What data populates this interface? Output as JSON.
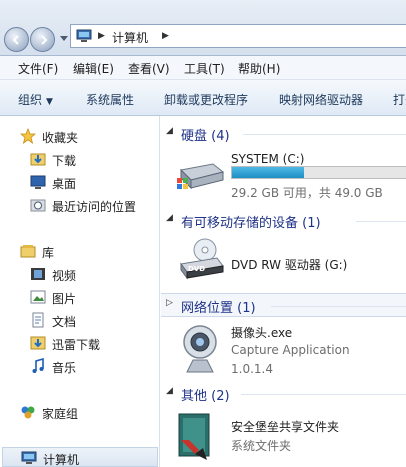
{
  "address": {
    "location": "计算机"
  },
  "menu": {
    "items": [
      "文件(F)",
      "编辑(E)",
      "查看(V)",
      "工具(T)",
      "帮助(H)"
    ]
  },
  "toolbar": {
    "organize": "组织",
    "system_properties": "系统属性",
    "uninstall": "卸载或更改程序",
    "map_drive": "映射网络驱动器",
    "open_cp": "打开"
  },
  "navpane": {
    "favorites": "收藏夹",
    "downloads": "下载",
    "desktop": "桌面",
    "recent": "最近访问的位置",
    "libraries": "库",
    "videos": "视频",
    "pictures": "图片",
    "documents": "文档",
    "thunder": "迅雷下载",
    "music": "音乐",
    "homegroup": "家庭组",
    "computer": "计算机"
  },
  "content": {
    "hard_disks": {
      "title": "硬盘 (4)",
      "drive_c": {
        "name": "SYSTEM (C:)",
        "free_text": "29.2 GB 可用，共 49.0 GB",
        "used_fraction": 0.404
      }
    },
    "removable": {
      "title": "有可移动存储的设备 (1)",
      "dvd": {
        "name": "DVD RW 驱动器 (G:)",
        "badge": "DVD"
      }
    },
    "network": {
      "title": "网络位置 (1)",
      "camera": {
        "name": "摄像头.exe",
        "desc": "Capture Application",
        "version": "1.0.1.4"
      }
    },
    "other": {
      "title": "其他 (2)",
      "share": {
        "name": "安全堡垒共享文件夹",
        "type": "系统文件夹"
      }
    }
  },
  "colors": {
    "group_title": "#1e3287",
    "capacity_fill": "#1f8fc4",
    "toolbar_text": "#1e395b"
  }
}
